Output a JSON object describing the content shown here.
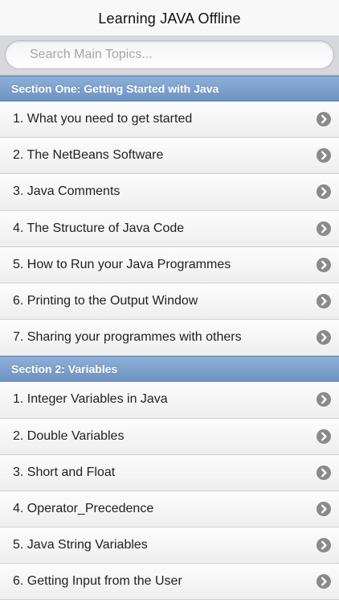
{
  "header": {
    "title": "Learning JAVA Offline"
  },
  "search": {
    "placeholder": "Search Main Topics..."
  },
  "sections": [
    {
      "title": "Section One: Getting Started with Java",
      "items": [
        "1. What you need to get started",
        "2. The NetBeans Software",
        "3. Java Comments",
        "4. The Structure of Java Code",
        "5. How to Run your Java Programmes",
        "6. Printing to the Output Window",
        "7. Sharing your programmes with others"
      ]
    },
    {
      "title": "Section 2: Variables",
      "items": [
        "1. Integer Variables in Java",
        "2. Double Variables",
        "3. Short and Float",
        "4. Operator_Precedence",
        "5. Java String Variables",
        "6. Getting Input from the User"
      ]
    }
  ],
  "icons": {
    "row_disclosure": "chevron-right-circle-icon"
  },
  "colors": {
    "section_header": "#7aa0cc",
    "disclosure_icon": "#8a8a8a"
  }
}
